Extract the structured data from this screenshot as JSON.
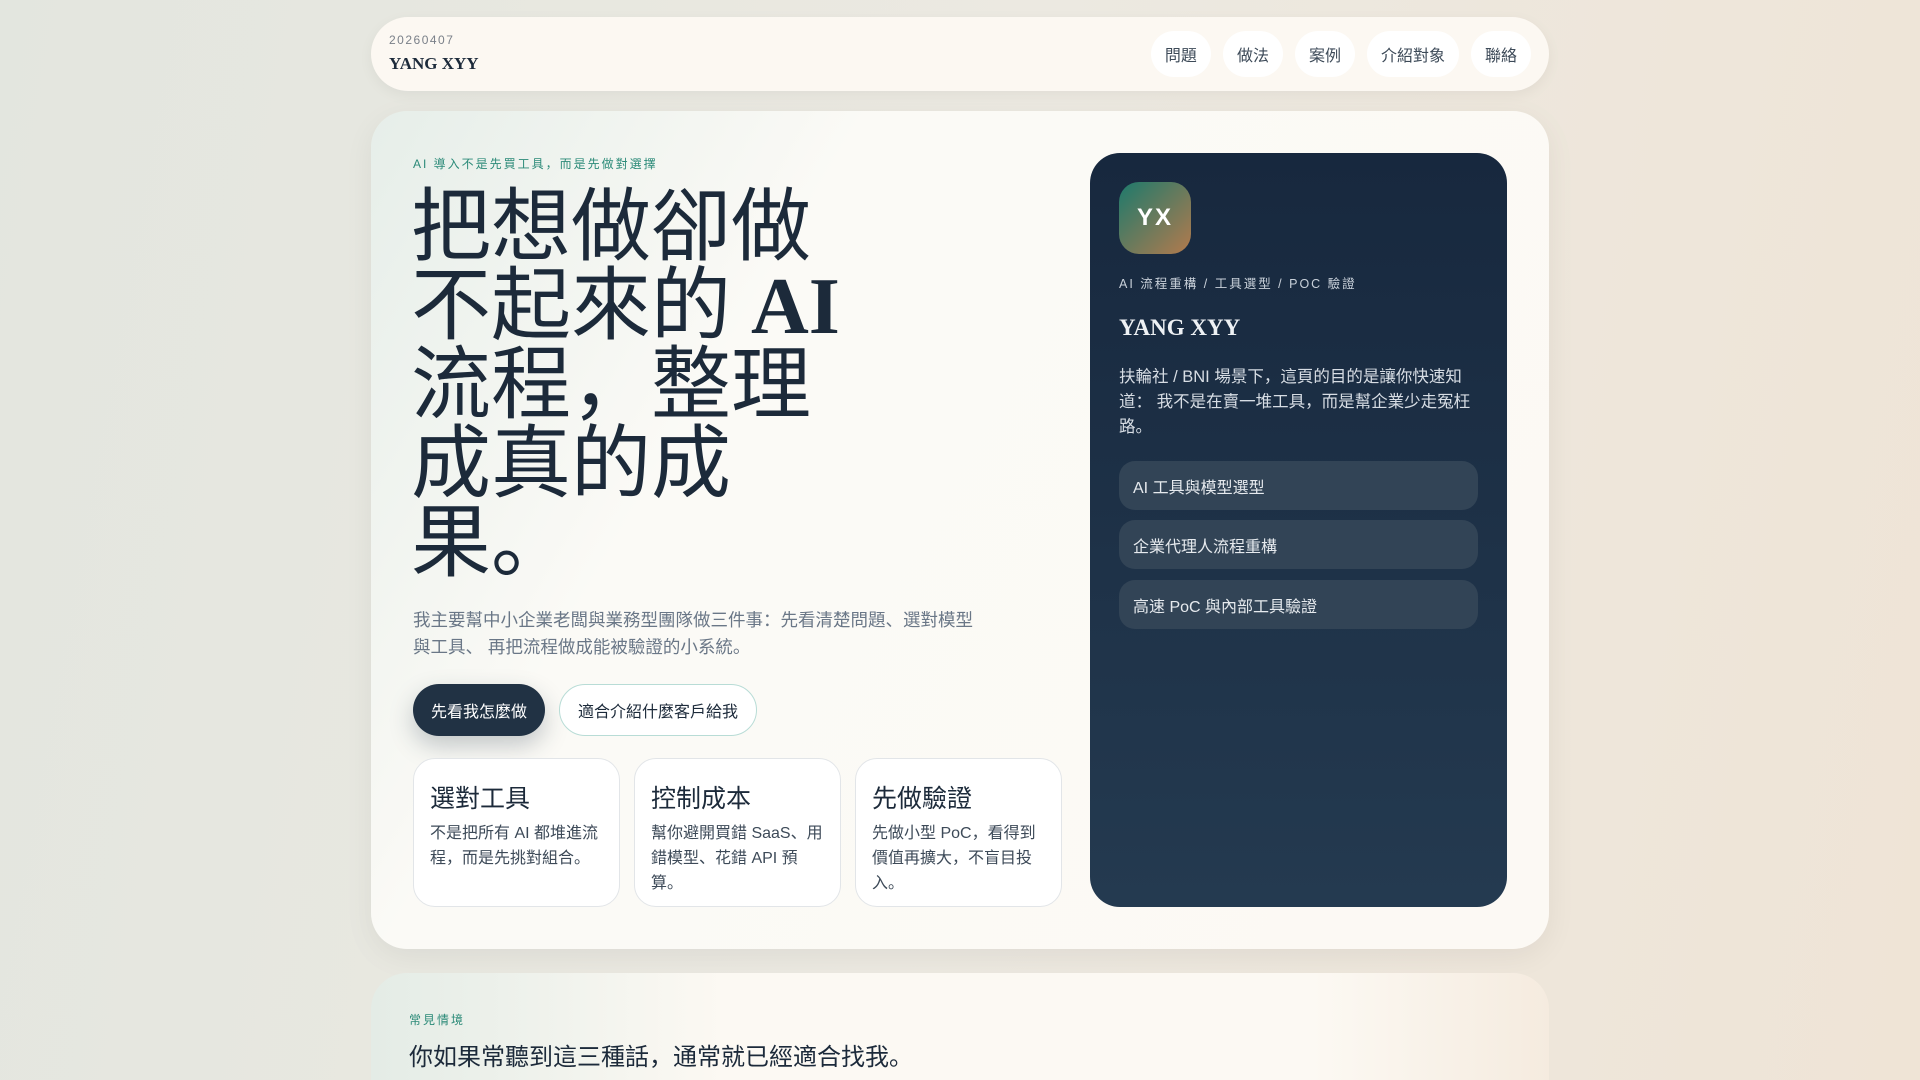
{
  "header": {
    "date": "20260407",
    "brand": "YANG XYY",
    "nav": [
      "問題",
      "做法",
      "案例",
      "介紹對象",
      "聯絡"
    ]
  },
  "hero": {
    "eyebrow": "AI 導入不是先買工具，而是先做對選擇",
    "headline_pre": "把想做卻做不起來的 ",
    "headline_ai": "AI",
    "headline_post": " 流程，整理成真的成果。",
    "description": "我主要幫中小企業老闆與業務型團隊做三件事：先看清楚問題、選對模型與工具、 再把流程做成能被驗證的小系統。",
    "primary_button": "先看我怎麼做",
    "secondary_button": "適合介紹什麼客戶給我",
    "cards": [
      {
        "title": "選對工具",
        "text": "不是把所有 AI 都堆進流程，而是先挑對組合。"
      },
      {
        "title": "控制成本",
        "text": "幫你避開買錯 SaaS、用錯模型、花錯 API 預算。"
      },
      {
        "title": "先做驗證",
        "text": "先做小型 PoC，看得到價值再擴大，不盲目投入。"
      }
    ]
  },
  "profile": {
    "initials": "YX",
    "tagline": "AI 流程重構 / 工具選型 / POC 驗證",
    "name": "YANG XYY",
    "description": "扶輪社 / BNI 場景下，這頁的目的是讓你快速知道： 我不是在賣一堆工具，而是幫企業少走冤枉路。",
    "items": [
      "AI 工具與模型選型",
      "企業代理人流程重構",
      "高速 PoC 與內部工具驗證"
    ]
  },
  "section2": {
    "eyebrow": "常見情境",
    "title": "你如果常聽到這三種話，通常就已經適合找我。"
  }
}
